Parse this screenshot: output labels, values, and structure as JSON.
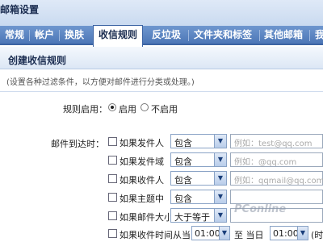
{
  "header": {
    "title": "邮箱设置"
  },
  "tabs": [
    {
      "label": "常规",
      "active": false
    },
    {
      "label": "帐户",
      "active": false
    },
    {
      "label": "换肤",
      "active": false
    },
    {
      "label": "收信规则",
      "active": true
    },
    {
      "label": "反垃圾",
      "active": false
    },
    {
      "label": "文件夹和标签",
      "active": false
    },
    {
      "label": "其他邮箱",
      "active": false
    },
    {
      "label": "我",
      "active": false
    }
  ],
  "section": {
    "title": "创建收信规则",
    "description": "(设置各种过滤条件，以方便对邮件进行分类或处理。)"
  },
  "rule_enable": {
    "label": "规则启用：",
    "on_label": "启用",
    "off_label": "不启用",
    "selected": "启用"
  },
  "conditions": {
    "label": "邮件到达时：",
    "rows": [
      {
        "label": "如果发件人",
        "operator": "包含",
        "placeholder": "例如：test@qq.com"
      },
      {
        "label": "如果发件域",
        "operator": "包含",
        "placeholder": "例如：@qq.com"
      },
      {
        "label": "如果收件人",
        "operator": "包含",
        "placeholder": "例如：qqmail@qq.com"
      },
      {
        "label": "如果主题中",
        "operator": "包含",
        "placeholder": ""
      },
      {
        "label": "如果邮件大小",
        "operator": "大于等于",
        "placeholder": ""
      }
    ],
    "time_row": {
      "label": "如果收件时间从当日",
      "from": "01:00",
      "to_label": "至 当日",
      "to": "01:00",
      "suffix": "(时"
    }
  },
  "watermark": "PConline"
}
